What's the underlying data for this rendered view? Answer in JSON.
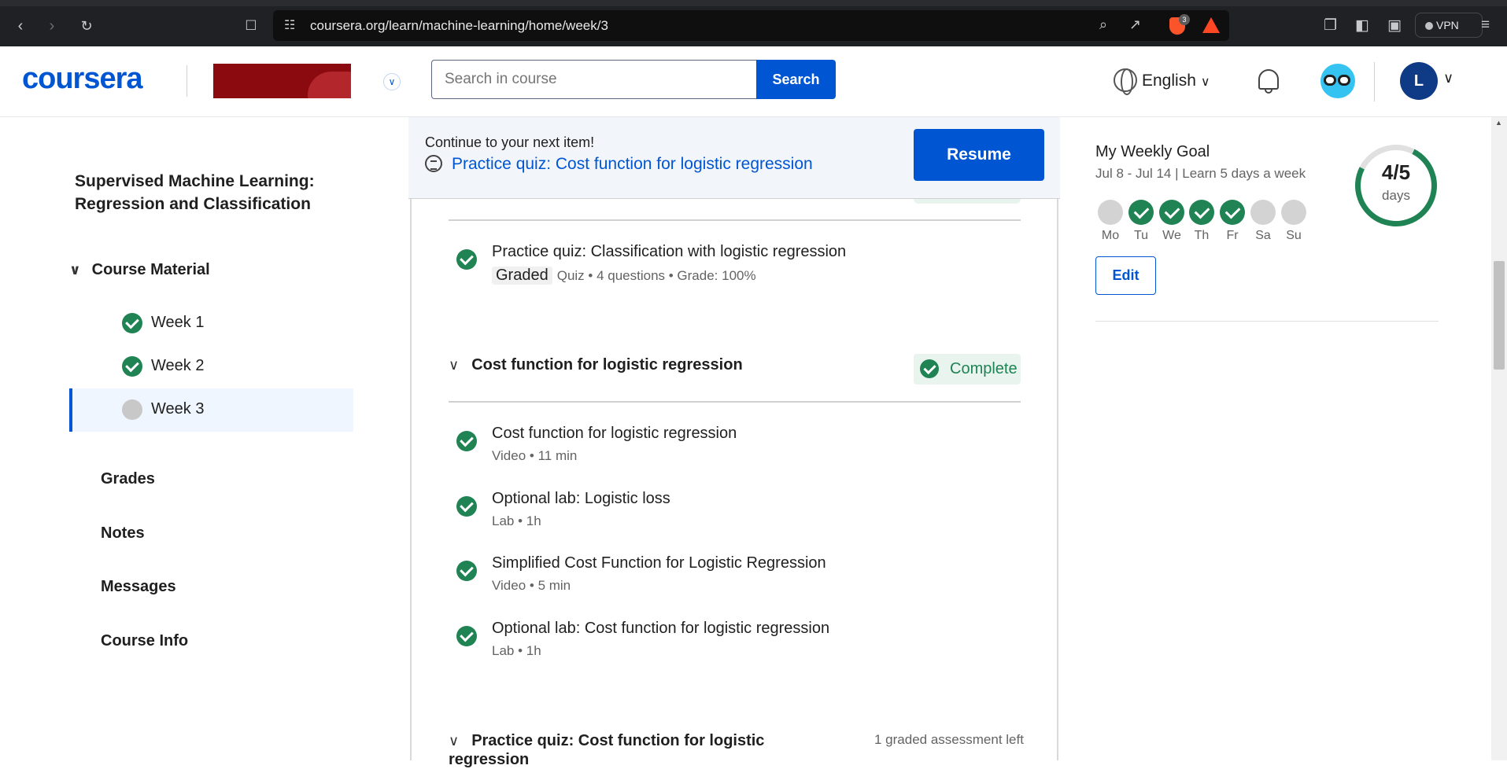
{
  "browser": {
    "url": "coursera.org/learn/machine-learning/home/week/3",
    "vpn_label": "VPN",
    "brave_badge": "3"
  },
  "header": {
    "logo": "coursera",
    "search_placeholder": "Search in course",
    "search_button": "Search",
    "language": "English",
    "avatar_initial": "L"
  },
  "sidebar": {
    "course_title": "Supervised Machine Learning: Regression and Classification",
    "course_material_label": "Course Material",
    "weeks": [
      {
        "label": "Week 1",
        "status": "complete"
      },
      {
        "label": "Week 2",
        "status": "complete"
      },
      {
        "label": "Week 3",
        "status": "incomplete"
      }
    ],
    "nav": [
      "Grades",
      "Notes",
      "Messages",
      "Course Info"
    ]
  },
  "resume": {
    "prompt": "Continue to your next item!",
    "next_item": "Practice quiz: Cost function for logistic regression",
    "button": "Resume"
  },
  "content": {
    "quiz_item": {
      "title": "Practice quiz: Classification with logistic regression",
      "graded": "Graded",
      "meta": "Quiz • 4 questions • Grade: 100%"
    },
    "section": {
      "title": "Cost function for logistic regression",
      "status": "Complete"
    },
    "items": [
      {
        "title": "Cost function for logistic regression",
        "meta": "Video • 11 min"
      },
      {
        "title": "Optional lab: Logistic loss",
        "meta": "Lab • 1h"
      },
      {
        "title": "Simplified Cost Function for Logistic Regression",
        "meta": "Video • 5 min"
      },
      {
        "title": "Optional lab: Cost function for logistic regression",
        "meta": "Lab • 1h"
      }
    ],
    "next_section": {
      "title": "Practice quiz: Cost function for logistic regression",
      "note": "1 graded assessment left"
    }
  },
  "weekly_goal": {
    "title": "My Weekly Goal",
    "subtitle": "Jul 8 - Jul 14 | Learn 5 days a week",
    "days": [
      {
        "label": "Mo",
        "done": false
      },
      {
        "label": "Tu",
        "done": true
      },
      {
        "label": "We",
        "done": true
      },
      {
        "label": "Th",
        "done": true
      },
      {
        "label": "Fr",
        "done": true
      },
      {
        "label": "Sa",
        "done": false
      },
      {
        "label": "Su",
        "done": false
      }
    ],
    "progress": "4/5",
    "progress_unit": "days",
    "edit_button": "Edit"
  },
  "colors": {
    "brand": "#0056d2",
    "complete_green": "#1f8354"
  }
}
